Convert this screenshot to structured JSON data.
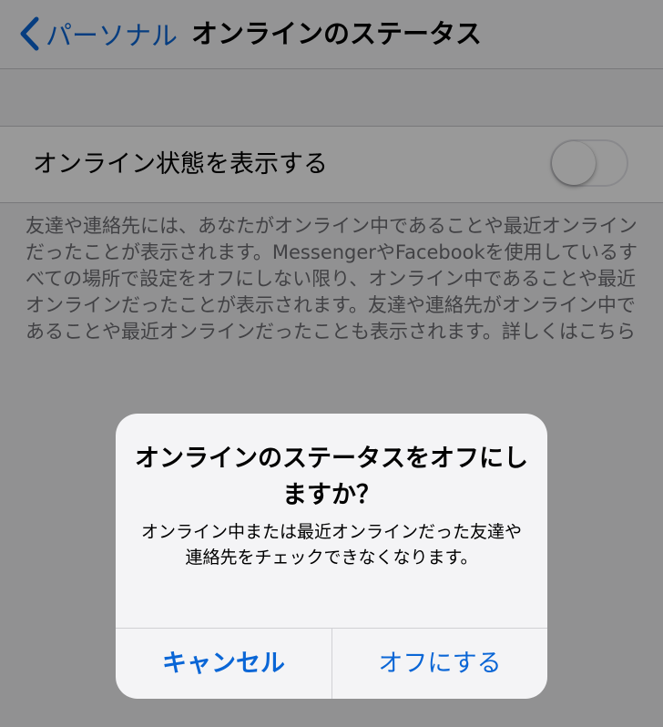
{
  "navbar": {
    "back_label": "パーソナル",
    "title": "オンラインのステータス"
  },
  "setting": {
    "label": "オンライン状態を表示する",
    "toggle_on": false
  },
  "footer": {
    "text": "友達や連絡先には、あなたがオンライン中であることや最近オンラインだったことが表示されます。MessengerやFacebookを使用しているすべての場所で設定をオフにしない限り、オンライン中であることや最近オンラインだったことが表示されます。友達や連絡先がオンライン中であることや最近オンラインだったことも表示されます。詳しくはこちら"
  },
  "alert": {
    "title": "オンラインのステータスをオフにしますか？",
    "message": "オンライン中または最近オンラインだった友達や連絡先をチェックできなくなります。",
    "cancel_label": "キャンセル",
    "confirm_label": "オフにする"
  },
  "colors": {
    "accent": "#0a66d6",
    "overlay": "rgba(0,0,0,0.4)"
  },
  "icons": {
    "back": "chevron-left-icon"
  }
}
